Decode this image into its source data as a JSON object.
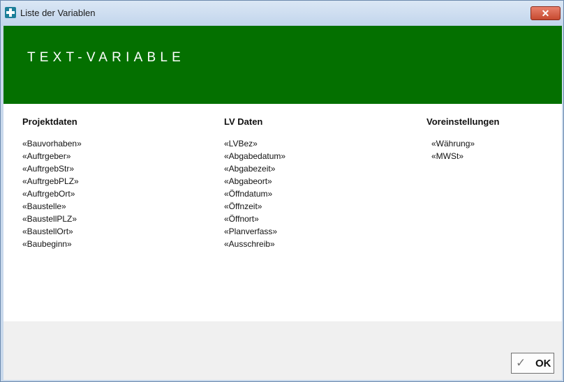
{
  "window": {
    "title": "Liste der Variablen",
    "close_label": "✕",
    "app_icon": "app-icon"
  },
  "banner": {
    "title": "TEXT-VARIABLE",
    "color": "#047000"
  },
  "columns": [
    {
      "header": "Projektdaten",
      "items": [
        "«Bauvorhaben»",
        "«Auftrgeber»",
        "«AuftrgebStr»",
        "«AuftrgebPLZ»",
        "«AuftrgebOrt»",
        "«Baustelle»",
        "«BaustellPLZ»",
        "«BaustellOrt»",
        "«Baubeginn»"
      ]
    },
    {
      "header": "LV Daten",
      "items": [
        "«LVBez»",
        "«Abgabedatum»",
        "«Abgabezeit»",
        "«Abgabeort»",
        "«Öffndatum»",
        "«Öffnzeit»",
        "«Öffnort»",
        "«Planverfass»",
        "«Ausschreib»"
      ]
    },
    {
      "header": "Voreinstellungen",
      "items": [
        "«Währung»",
        "«MWSt»"
      ]
    }
  ],
  "footer": {
    "ok_label": "OK",
    "ok_icon": "✓"
  }
}
